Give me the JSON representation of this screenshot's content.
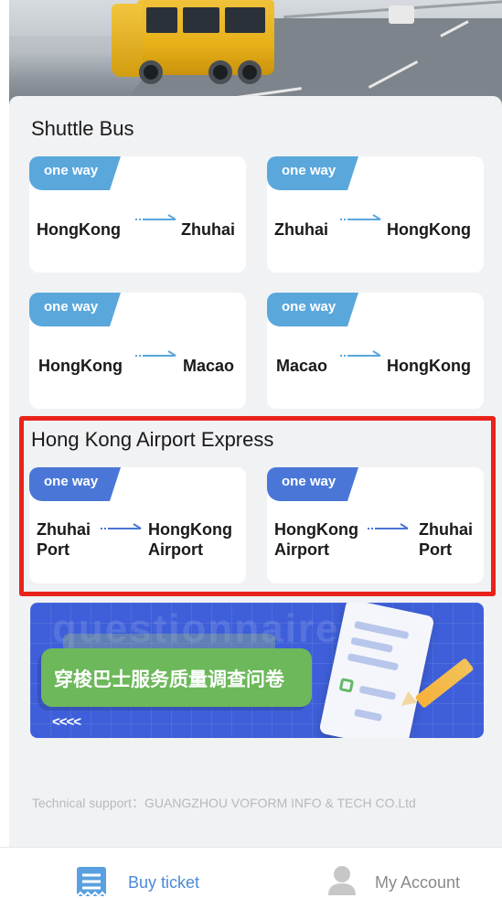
{
  "shuttle": {
    "title": "Shuttle Bus",
    "routes": [
      {
        "tag": "one way",
        "from": "HongKong",
        "to": "Zhuhai"
      },
      {
        "tag": "one way",
        "from": "Zhuhai",
        "to": "HongKong"
      },
      {
        "tag": "one way",
        "from": "HongKong",
        "to": "Macao"
      },
      {
        "tag": "one way",
        "from": "Macao",
        "to": "HongKong"
      }
    ]
  },
  "airport": {
    "title": "Hong Kong Airport Express",
    "routes": [
      {
        "tag": "one way",
        "from_line1": "Zhuhai",
        "from_line2": "Port",
        "to_line1": "HongKong",
        "to_line2": "Airport"
      },
      {
        "tag": "one way",
        "from_line1": "HongKong",
        "from_line2": "Airport",
        "to_line1": "Zhuhai",
        "to_line2": "Port"
      }
    ]
  },
  "questionnaire": {
    "ghost_text": "questionnaire",
    "title": "穿梭巴士服务质量调查问卷",
    "chevrons": "<<<<"
  },
  "footer": {
    "tech_support": "Technical support：GUANGZHOU VOFORM INFO & TECH CO.Ltd"
  },
  "tabbar": {
    "buy": {
      "label": "Buy ticket",
      "icon": "ticket-icon",
      "active": true
    },
    "account": {
      "label": "My Account",
      "icon": "user-icon",
      "active": false
    }
  },
  "colors": {
    "highlight": "#e8231c",
    "tag_light": "#5aa7dc",
    "tag_dark": "#4a77d7",
    "active_tab": "#4a8ad8",
    "banner": "#3e5fd9"
  }
}
